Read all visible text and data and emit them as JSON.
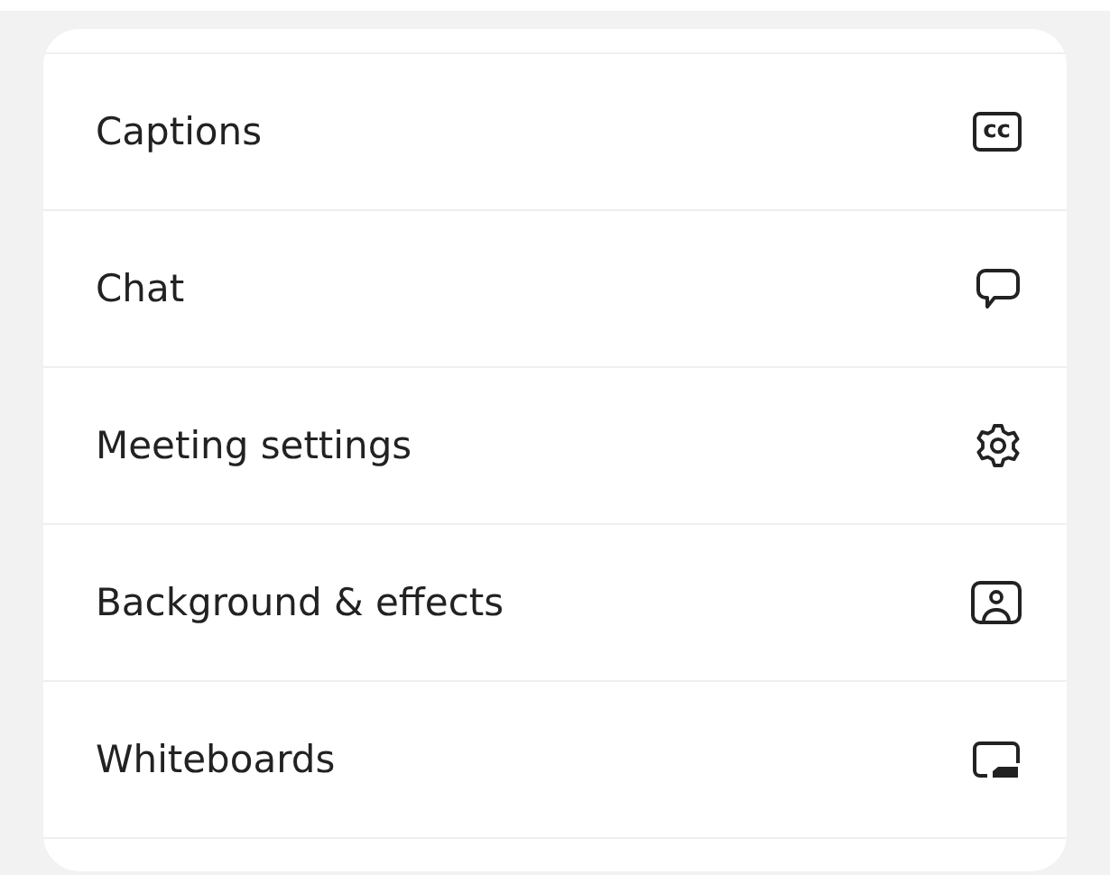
{
  "menu": {
    "items": [
      {
        "label": "Captions",
        "kind": "cc",
        "badge": "cc"
      },
      {
        "label": "Chat",
        "kind": "chat"
      },
      {
        "label": "Meeting settings",
        "kind": "gear"
      },
      {
        "label": "Background & effects",
        "kind": "person"
      },
      {
        "label": "Whiteboards",
        "kind": "whiteboard"
      }
    ]
  }
}
